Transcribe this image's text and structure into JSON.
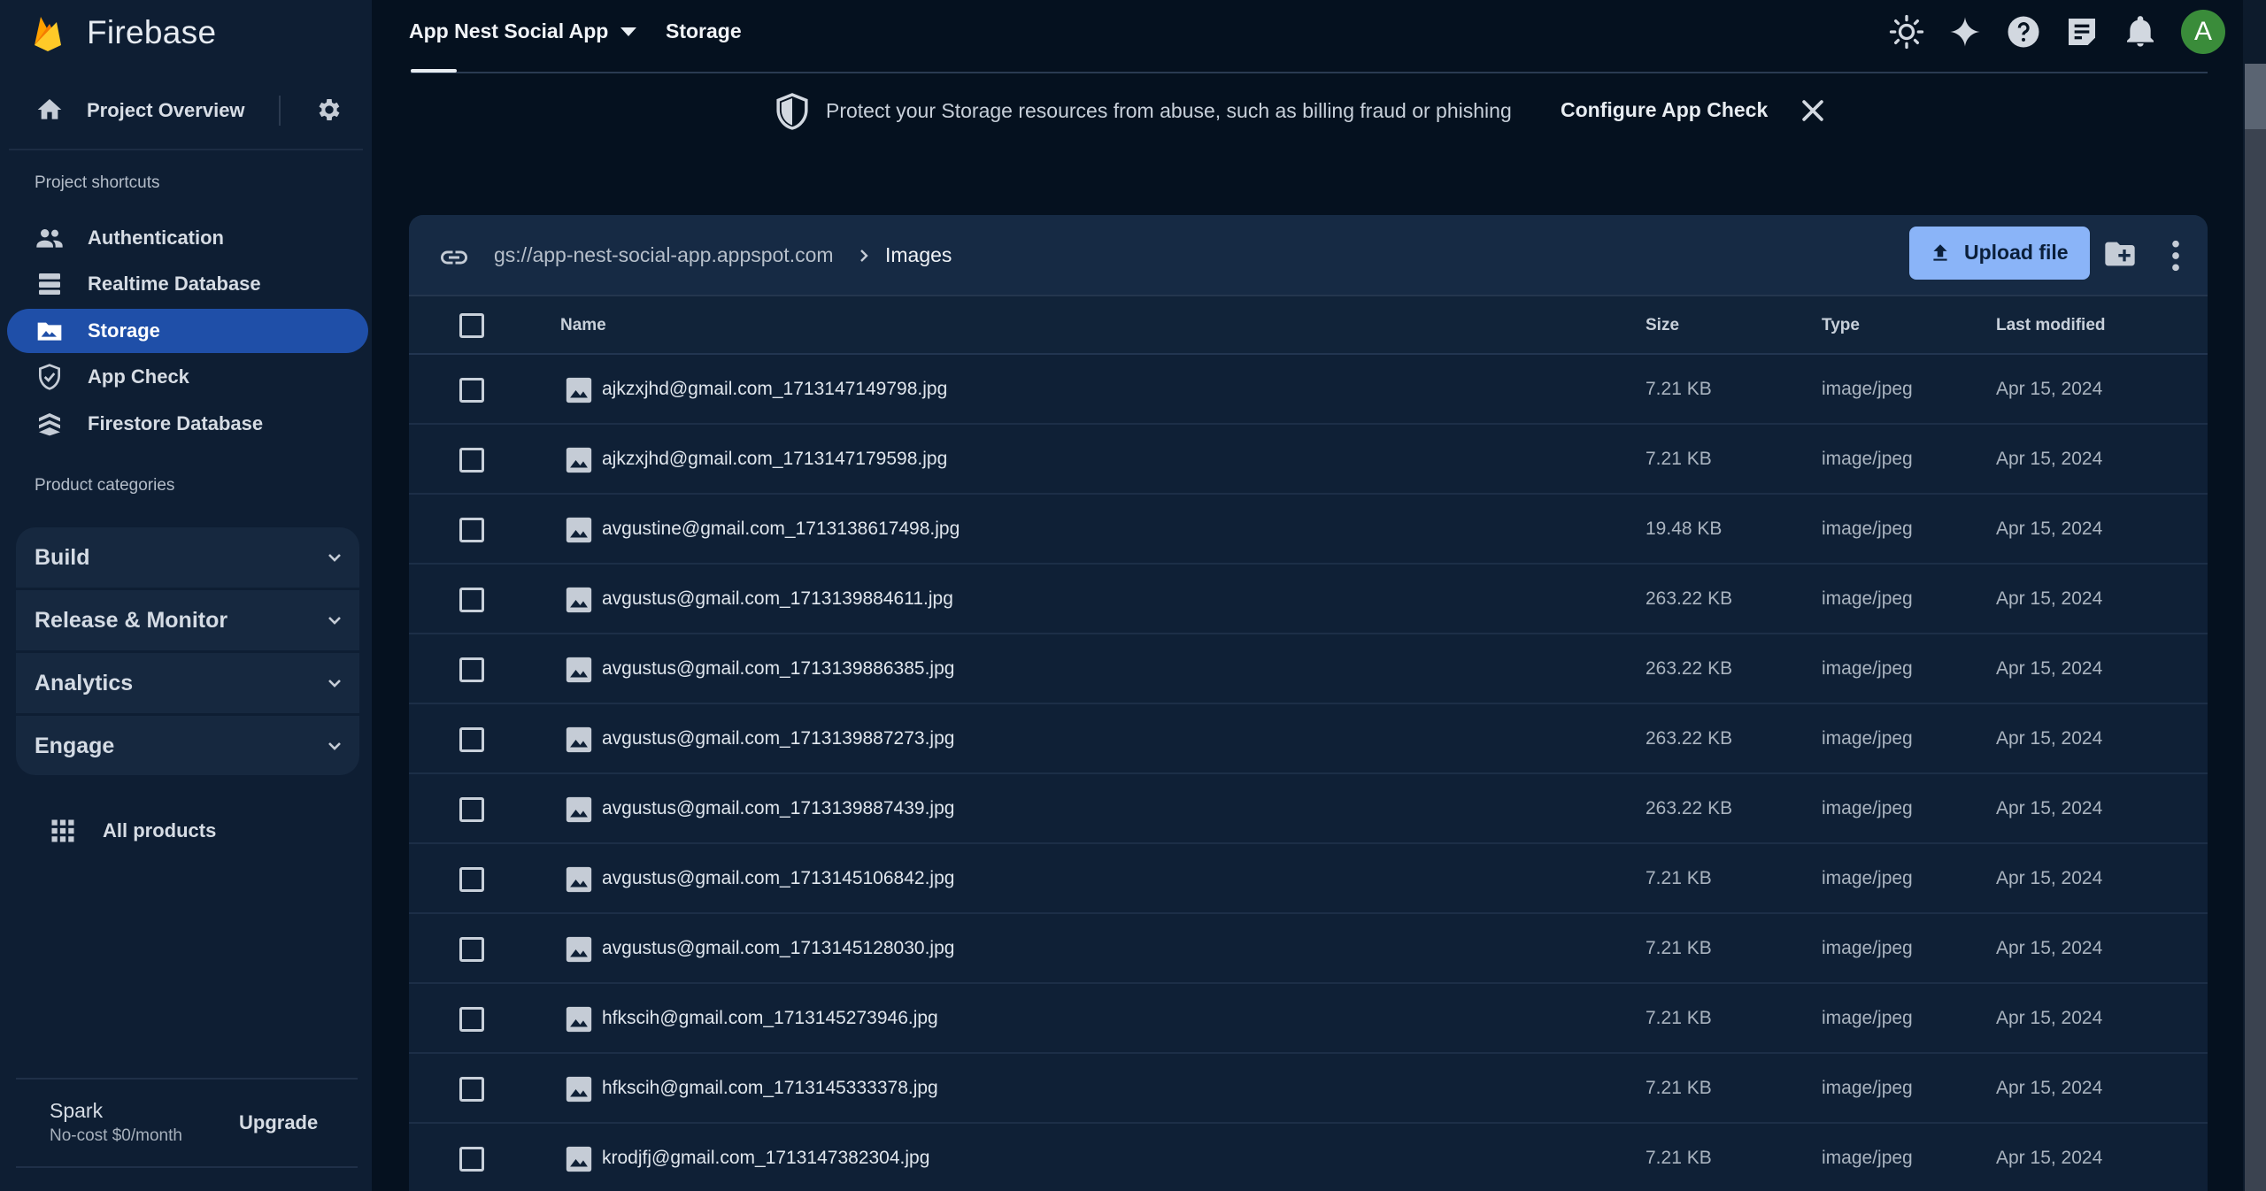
{
  "app": {
    "brand": "Firebase",
    "project_name": "App Nest Social App",
    "page_title": "Storage",
    "avatar_initial": "A"
  },
  "sidebar": {
    "overview_label": "Project Overview",
    "shortcuts_title": "Project shortcuts",
    "shortcuts": [
      {
        "label": "Authentication",
        "icon": "people-icon"
      },
      {
        "label": "Realtime Database",
        "icon": "database-icon"
      },
      {
        "label": "Storage",
        "icon": "storage-photo-icon",
        "active": true
      },
      {
        "label": "App Check",
        "icon": "shield-check-icon"
      },
      {
        "label": "Firestore Database",
        "icon": "firestore-icon"
      }
    ],
    "categories_title": "Product categories",
    "categories": [
      "Build",
      "Release & Monitor",
      "Analytics",
      "Engage"
    ],
    "all_products": "All products",
    "plan": {
      "name": "Spark",
      "price": "No-cost $0/month",
      "upgrade": "Upgrade"
    }
  },
  "banner": {
    "message": "Protect your Storage resources from abuse, such as billing fraud or phishing",
    "cta": "Configure App Check"
  },
  "storage": {
    "bucket": "gs://app-nest-social-app.appspot.com",
    "folder": "Images",
    "upload_label": "Upload file",
    "columns": {
      "name": "Name",
      "size": "Size",
      "type": "Type",
      "modified": "Last modified"
    },
    "files": [
      {
        "name": "ajkzxjhd@gmail.com_1713147149798.jpg",
        "size": "7.21 KB",
        "type": "image/jpeg",
        "modified": "Apr 15, 2024"
      },
      {
        "name": "ajkzxjhd@gmail.com_1713147179598.jpg",
        "size": "7.21 KB",
        "type": "image/jpeg",
        "modified": "Apr 15, 2024"
      },
      {
        "name": "avgustine@gmail.com_1713138617498.jpg",
        "size": "19.48 KB",
        "type": "image/jpeg",
        "modified": "Apr 15, 2024"
      },
      {
        "name": "avgustus@gmail.com_1713139884611.jpg",
        "size": "263.22 KB",
        "type": "image/jpeg",
        "modified": "Apr 15, 2024"
      },
      {
        "name": "avgustus@gmail.com_1713139886385.jpg",
        "size": "263.22 KB",
        "type": "image/jpeg",
        "modified": "Apr 15, 2024"
      },
      {
        "name": "avgustus@gmail.com_1713139887273.jpg",
        "size": "263.22 KB",
        "type": "image/jpeg",
        "modified": "Apr 15, 2024"
      },
      {
        "name": "avgustus@gmail.com_1713139887439.jpg",
        "size": "263.22 KB",
        "type": "image/jpeg",
        "modified": "Apr 15, 2024"
      },
      {
        "name": "avgustus@gmail.com_1713145106842.jpg",
        "size": "7.21 KB",
        "type": "image/jpeg",
        "modified": "Apr 15, 2024"
      },
      {
        "name": "avgustus@gmail.com_1713145128030.jpg",
        "size": "7.21 KB",
        "type": "image/jpeg",
        "modified": "Apr 15, 2024"
      },
      {
        "name": "hfkscih@gmail.com_1713145273946.jpg",
        "size": "7.21 KB",
        "type": "image/jpeg",
        "modified": "Apr 15, 2024"
      },
      {
        "name": "hfkscih@gmail.com_1713145333378.jpg",
        "size": "7.21 KB",
        "type": "image/jpeg",
        "modified": "Apr 15, 2024"
      },
      {
        "name": "krodjfj@gmail.com_1713147382304.jpg",
        "size": "7.21 KB",
        "type": "image/jpeg",
        "modified": "Apr 15, 2024"
      }
    ]
  },
  "colors": {
    "background": "#05111f",
    "sidebar": "#0e1e33",
    "active_nav": "#1f4fa8",
    "upload_button": "#8ab4f8",
    "avatar": "#3a8c3a"
  }
}
